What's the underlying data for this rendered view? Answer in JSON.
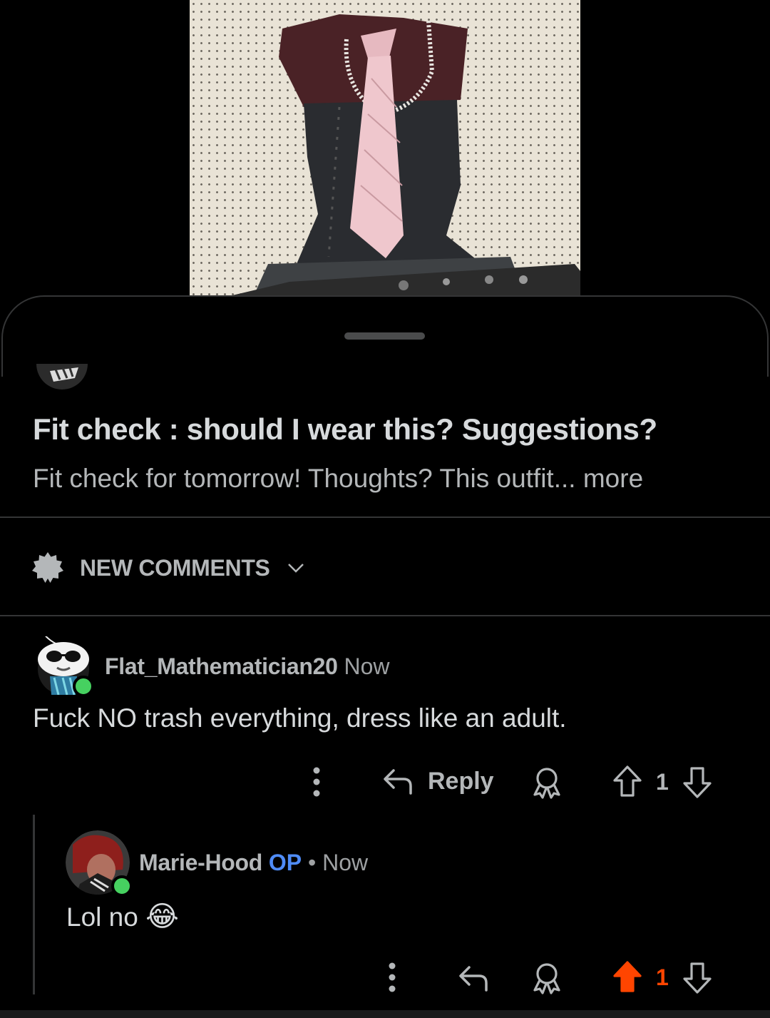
{
  "post": {
    "title": "Fit check : should I wear this? Suggestions?",
    "body_preview": "Fit check for tomorrow! Thoughts? This outfit...",
    "more_label": "more"
  },
  "sort": {
    "label": "NEW COMMENTS",
    "icon": "sparkle-badge-icon"
  },
  "comments": [
    {
      "username": "Flat_Mathematician20",
      "time": "Now",
      "text": "Fuck NO trash everything, dress like an adult.",
      "reply_label": "Reply",
      "vote_count": "1",
      "upvoted": false
    },
    {
      "username": "Marie-Hood",
      "op_badge": "OP",
      "separator": "•",
      "time": "Now",
      "text": "Lol no",
      "emoji": "😂",
      "vote_count": "1",
      "upvoted": true
    }
  ],
  "colors": {
    "background": "#000000",
    "text_primary": "#d7dadc",
    "text_secondary": "#b4b7b9",
    "op_blue": "#4f8cf7",
    "upvote_orange": "#ff4500",
    "online_green": "#46d160",
    "divider": "#343536"
  }
}
